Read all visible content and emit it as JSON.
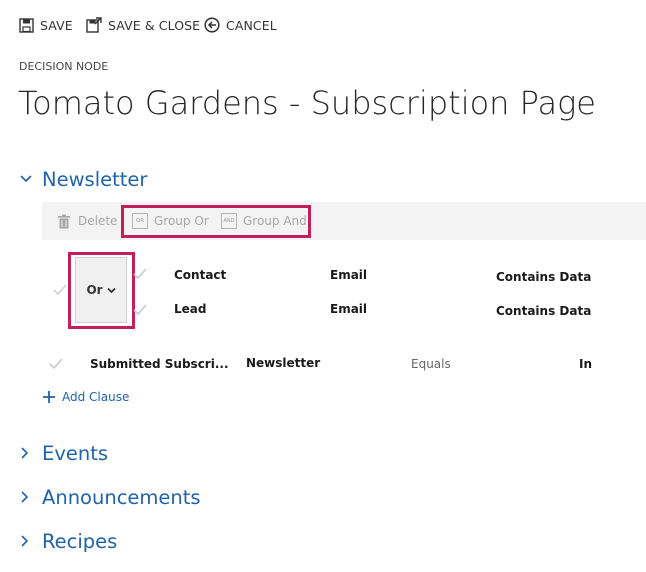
{
  "toolbar": {
    "save": "SAVE",
    "save_close": "SAVE & CLOSE",
    "cancel": "CANCEL"
  },
  "header": {
    "breadcrumb": "DECISION NODE",
    "title": "Tomato Gardens - Subscription Page"
  },
  "sections": {
    "newsletter": "Newsletter",
    "events": "Events",
    "announcements": "Announcements",
    "recipes": "Recipes"
  },
  "sub_toolbar": {
    "delete": "Delete",
    "group_or": "Group Or",
    "group_and": "Group And",
    "or_icon": "OR",
    "and_icon": "AND"
  },
  "group": {
    "operator": "Or",
    "clauses": [
      {
        "entity": "Contact",
        "field": "Email",
        "operator": "Contains Data"
      },
      {
        "entity": "Lead",
        "field": "Email",
        "operator": "Contains Data"
      }
    ]
  },
  "clause": {
    "entity": "Submitted Subscri...",
    "field": "Newsletter",
    "operator": "Equals",
    "value": "In"
  },
  "add_clause": "Add Clause",
  "colors": {
    "accent": "#1f63ad",
    "highlight": "#c41f5a"
  }
}
